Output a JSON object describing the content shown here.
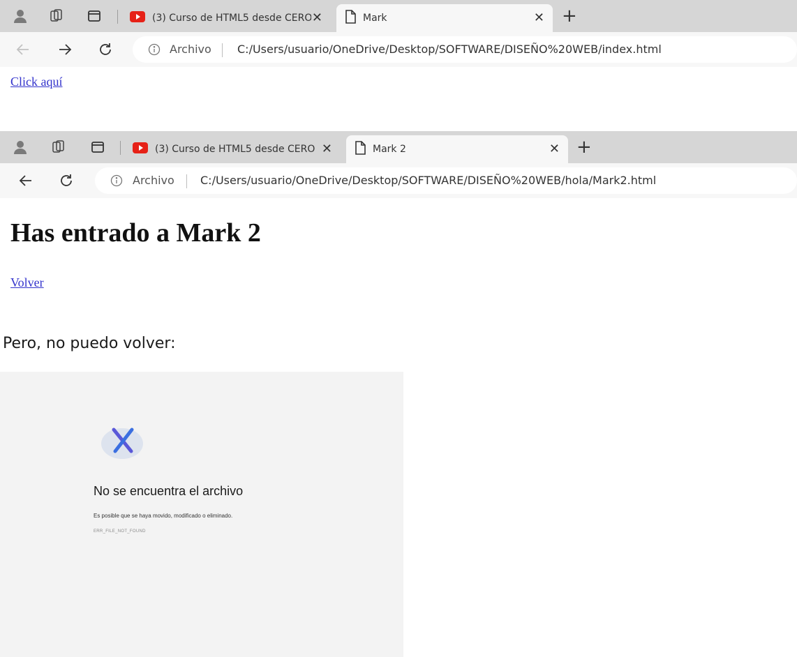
{
  "browser1": {
    "tabs": [
      {
        "title": "(3) Curso de HTML5 desde CERO",
        "icon": "youtube-icon",
        "active": false
      },
      {
        "title": "Mark",
        "icon": "page-icon",
        "active": true
      }
    ],
    "address": {
      "label": "Archivo",
      "url": "C:/Users/usuario/OneDrive/Desktop/SOFTWARE/DISEÑO%20WEB/index.html"
    },
    "page": {
      "link_text": "Click aquí"
    }
  },
  "browser2": {
    "tabs": [
      {
        "title": "(3) Curso de HTML5 desde CERO",
        "icon": "youtube-icon",
        "active": false
      },
      {
        "title": "Mark 2",
        "icon": "page-icon",
        "active": true
      }
    ],
    "address": {
      "label": "Archivo",
      "url": "C:/Users/usuario/OneDrive/Desktop/SOFTWARE/DISEÑO%20WEB/hola/Mark2.html"
    },
    "page": {
      "heading": "Has entrado a Mark 2",
      "link_text": "Volver"
    }
  },
  "caption": "Pero, no puedo volver:",
  "error_page": {
    "title": "No se encuentra el archivo",
    "description": "Es posible que se haya movido, modificado o eliminado.",
    "code": "ERR_FILE_NOT_FOUND"
  },
  "colors": {
    "tabbar": "#d6d6d6",
    "active_tab": "#f7f7f7",
    "link": "#3333cc",
    "youtube": "#e62117",
    "error_bg": "#f3f3f3"
  }
}
